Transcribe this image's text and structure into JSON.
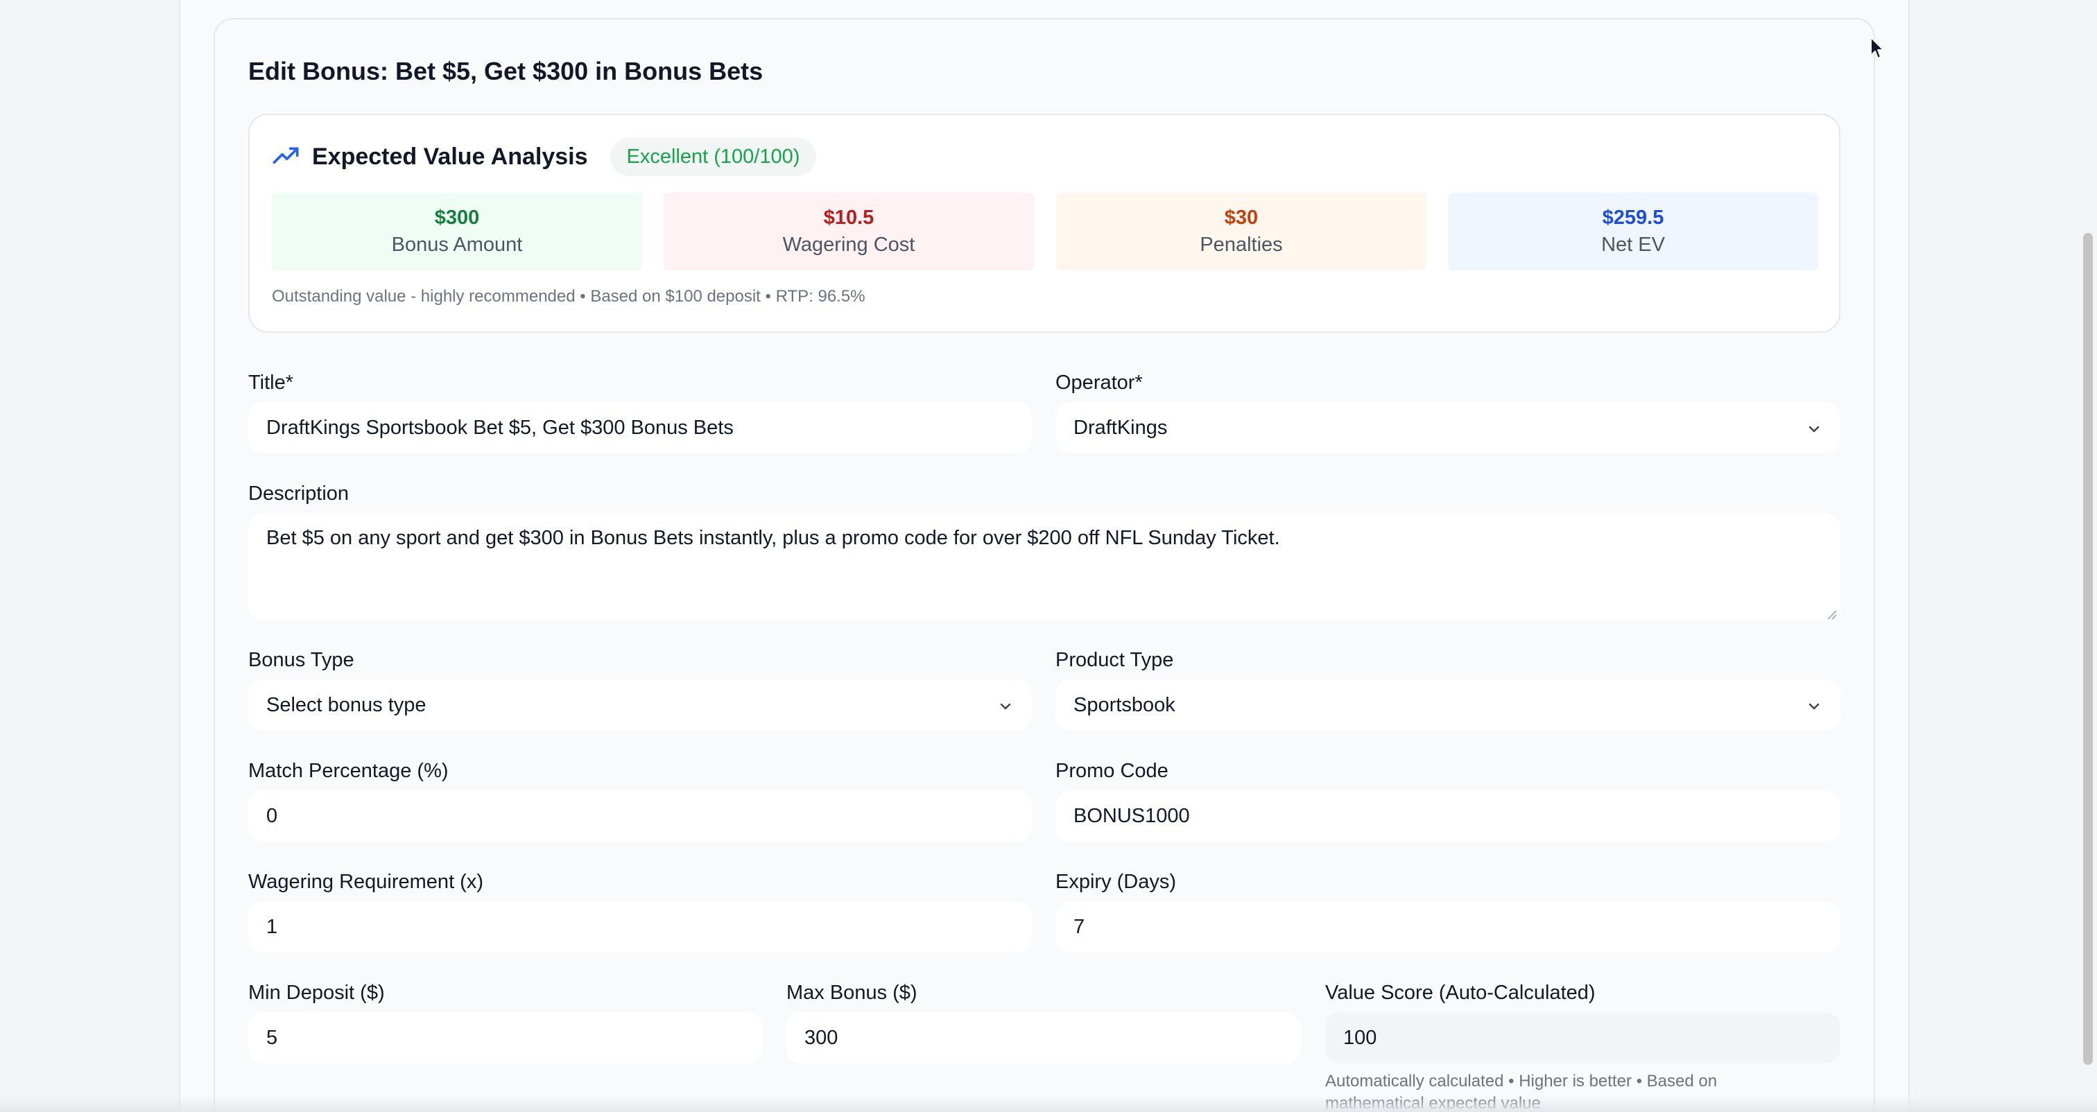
{
  "form": {
    "heading": "Edit Bonus: Bet $5, Get $300 in Bonus Bets"
  },
  "ev": {
    "title": "Expected Value Analysis",
    "badge": "Excellent (100/100)",
    "metrics": [
      {
        "value": "$300",
        "label": "Bonus Amount",
        "color": "#15803d"
      },
      {
        "value": "$10.5",
        "label": "Wagering Cost",
        "color": "#b91c1c"
      },
      {
        "value": "$30",
        "label": "Penalties",
        "color": "#c2410c"
      },
      {
        "value": "$259.5",
        "label": "Net EV",
        "color": "#1d4ed8"
      }
    ],
    "note": "Outstanding value - highly recommended • Based on $100 deposit • RTP: 96.5%"
  },
  "fields": {
    "title": {
      "label": "Title*",
      "value": "DraftKings Sportsbook Bet $5, Get $300 Bonus Bets"
    },
    "operator": {
      "label": "Operator*",
      "value": "DraftKings"
    },
    "description": {
      "label": "Description",
      "value": "Bet $5 on any sport and get $300 in Bonus Bets instantly, plus a promo code for over $200 off NFL Sunday Ticket."
    },
    "bonus_type": {
      "label": "Bonus Type",
      "value": "Select bonus type"
    },
    "product_type": {
      "label": "Product Type",
      "value": "Sportsbook"
    },
    "match_percentage": {
      "label": "Match Percentage (%)",
      "value": "0"
    },
    "promo_code": {
      "label": "Promo Code",
      "value": "BONUS1000"
    },
    "wagering": {
      "label": "Wagering Requirement (x)",
      "value": "1"
    },
    "expiry": {
      "label": "Expiry (Days)",
      "value": "7"
    },
    "min_deposit": {
      "label": "Min Deposit ($)",
      "value": "5"
    },
    "max_bonus": {
      "label": "Max Bonus ($)",
      "value": "300"
    },
    "value_score": {
      "label": "Value Score (Auto-Calculated)",
      "value": "100",
      "helper": "Automatically calculated • Higher is better • Based on mathematical expected value"
    }
  },
  "icons": {
    "trend": "trending-up-icon",
    "chevron": "chevron-down-icon"
  }
}
